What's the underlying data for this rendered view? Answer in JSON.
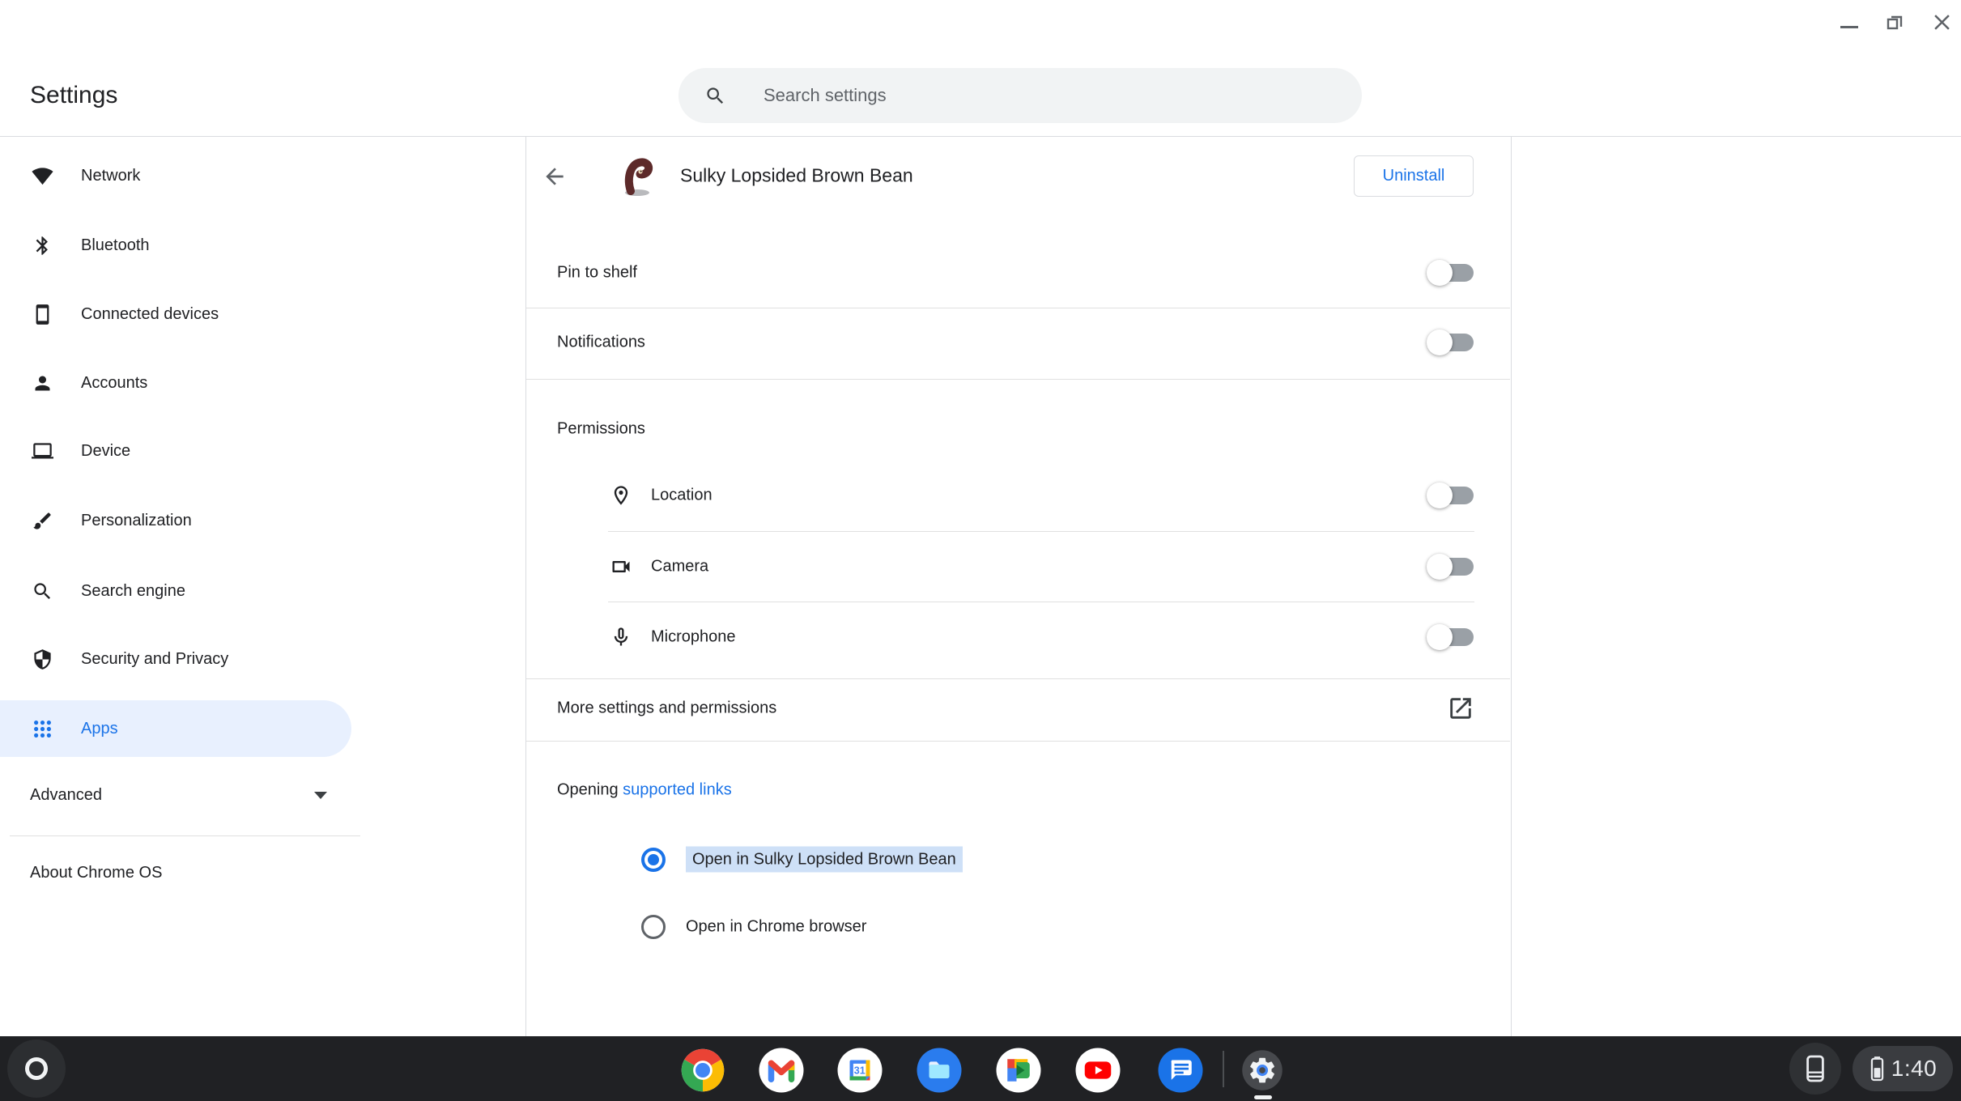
{
  "window": {
    "controls": {
      "minimize": "minimize",
      "restore": "restore",
      "close": "close"
    }
  },
  "header": {
    "title": "Settings",
    "search_placeholder": "Search settings",
    "search_icon": "search-icon"
  },
  "sidebar": {
    "items": [
      {
        "icon": "wifi-icon",
        "label": "Network"
      },
      {
        "icon": "bluetooth-icon",
        "label": "Bluetooth"
      },
      {
        "icon": "smartphone-icon",
        "label": "Connected devices"
      },
      {
        "icon": "person-icon",
        "label": "Accounts"
      },
      {
        "icon": "laptop-icon",
        "label": "Device"
      },
      {
        "icon": "brush-icon",
        "label": "Personalization"
      },
      {
        "icon": "search-icon",
        "label": "Search engine"
      },
      {
        "icon": "shield-icon",
        "label": "Security and Privacy"
      },
      {
        "icon": "apps-grid-icon",
        "label": "Apps",
        "selected": true
      }
    ],
    "advanced_label": "Advanced",
    "about_label": "About Chrome OS"
  },
  "app_page": {
    "back_icon": "back-arrow-icon",
    "app_icon": "sulky-bean-app-icon",
    "app_name": "Sulky Lopsided Brown Bean",
    "uninstall_label": "Uninstall",
    "toggles": [
      {
        "label": "Pin to shelf",
        "state": "off"
      },
      {
        "label": "Notifications",
        "state": "off"
      }
    ],
    "permissions": {
      "heading": "Permissions",
      "rows": [
        {
          "icon": "location-pin-icon",
          "label": "Location",
          "state": "off"
        },
        {
          "icon": "videocam-icon",
          "label": "Camera",
          "state": "off"
        },
        {
          "icon": "microphone-icon",
          "label": "Microphone",
          "state": "off"
        }
      ]
    },
    "more_settings_label": "More settings and permissions",
    "external_link_icon": "open-in-new-icon",
    "opening": {
      "prefix": "Opening ",
      "link_label": "supported links",
      "options": [
        {
          "label": "Open in Sulky Lopsided Brown Bean",
          "selected": true,
          "highlighted": true
        },
        {
          "label": "Open in Chrome browser",
          "selected": false,
          "highlighted": false
        }
      ]
    }
  },
  "shelf": {
    "launcher_icon": "launcher-icon",
    "apps": [
      "chrome",
      "gmail",
      "calendar",
      "files",
      "meet",
      "youtube",
      "messages",
      "settings"
    ],
    "active_app": "settings",
    "status": {
      "phone_hub_icon": "phone-hub-icon",
      "battery_icon": "battery-icon",
      "time": "1:40"
    }
  },
  "colors": {
    "accent_blue": "#1a73e8",
    "selected_item_bg": "#e8f0fe",
    "selection_highlight": "#cee0f7",
    "shelf_bg": "#202124",
    "search_bg": "#f1f3f4",
    "divider": "#e0e0e0",
    "text_primary": "#202124",
    "text_secondary": "#5f6368"
  }
}
